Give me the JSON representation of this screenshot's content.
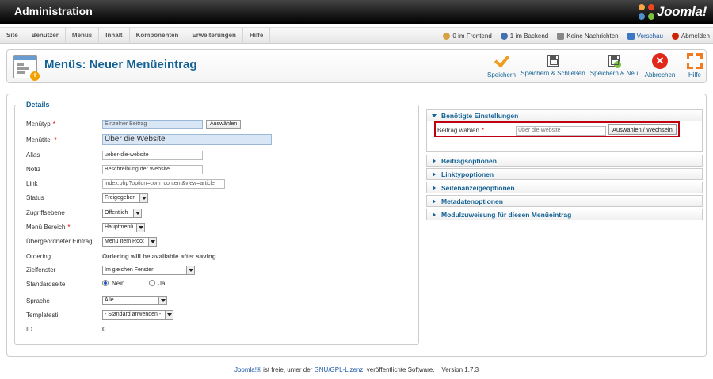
{
  "header": {
    "title": "Administration",
    "brand": "Joomla!"
  },
  "menubar": {
    "items": [
      "Site",
      "Benutzer",
      "Menüs",
      "Inhalt",
      "Komponenten",
      "Erweiterungen",
      "Hilfe"
    ],
    "status": {
      "frontend": "0 im Frontend",
      "backend": "1 im Backend",
      "messages": "Keine Nachrichten",
      "preview": "Vorschau",
      "logout": "Abmelden"
    }
  },
  "toolbar": {
    "title": "Menüs: Neuer Menüeintrag",
    "buttons": [
      "Speichern",
      "Speichern & Schließen",
      "Speichern & Neu",
      "Abbrechen",
      "Hilfe"
    ]
  },
  "details": {
    "legend": "Details",
    "fields": {
      "menutype": {
        "label": "Menütyp",
        "value": "Einzelner Beitrag",
        "button": "Auswählen"
      },
      "title": {
        "label": "Menütitel",
        "value": "Über die Website"
      },
      "alias": {
        "label": "Alias",
        "value": "ueber-die-website"
      },
      "note": {
        "label": "Notiz",
        "value": "Beschreibung der Website"
      },
      "link": {
        "label": "Link",
        "value": "index.php?option=com_content&view=article"
      },
      "status": {
        "label": "Status",
        "value": "Freigegeben"
      },
      "access": {
        "label": "Zugriffsebene",
        "value": "Öffentlich"
      },
      "menu": {
        "label": "Menü Bereich",
        "value": "Hauptmenü"
      },
      "parent": {
        "label": "Übergeordneter Eintrag",
        "value": "Menu Item Root"
      },
      "ordering": {
        "label": "Ordering",
        "value": "Ordering will be available after saving"
      },
      "target": {
        "label": "Zielfenster",
        "value": "Im gleichen Fenster"
      },
      "home": {
        "label": "Standardseite",
        "no": "Nein",
        "yes": "Ja"
      },
      "language": {
        "label": "Sprache",
        "value": "Alle"
      },
      "template": {
        "label": "Templatestil",
        "value": "- Standard anwenden -"
      },
      "id": {
        "label": "ID",
        "value": "0"
      }
    }
  },
  "panels": {
    "required": {
      "title": "Benötigte Einstellungen",
      "field_label": "Beitrag wählen",
      "field_value": "Über die Website",
      "button": "Auswählen / Wechseln"
    },
    "collapsed": [
      "Beitragsoptionen",
      "Linktypoptionen",
      "Seitenanzeigeoptionen",
      "Metadatenoptionen",
      "Modulzuweisung für diesen Menüeintrag"
    ]
  },
  "footer": {
    "brand": "Joomla!®",
    "text1": " ist freie, unter der ",
    "license": "GNU/GPL-Lizenz",
    "text2": ", veröffentlichte Software.",
    "version": "Version 1.7.3"
  },
  "colors": {
    "accent": "#146295",
    "highlight": "#c00010",
    "required": "#e00000"
  }
}
